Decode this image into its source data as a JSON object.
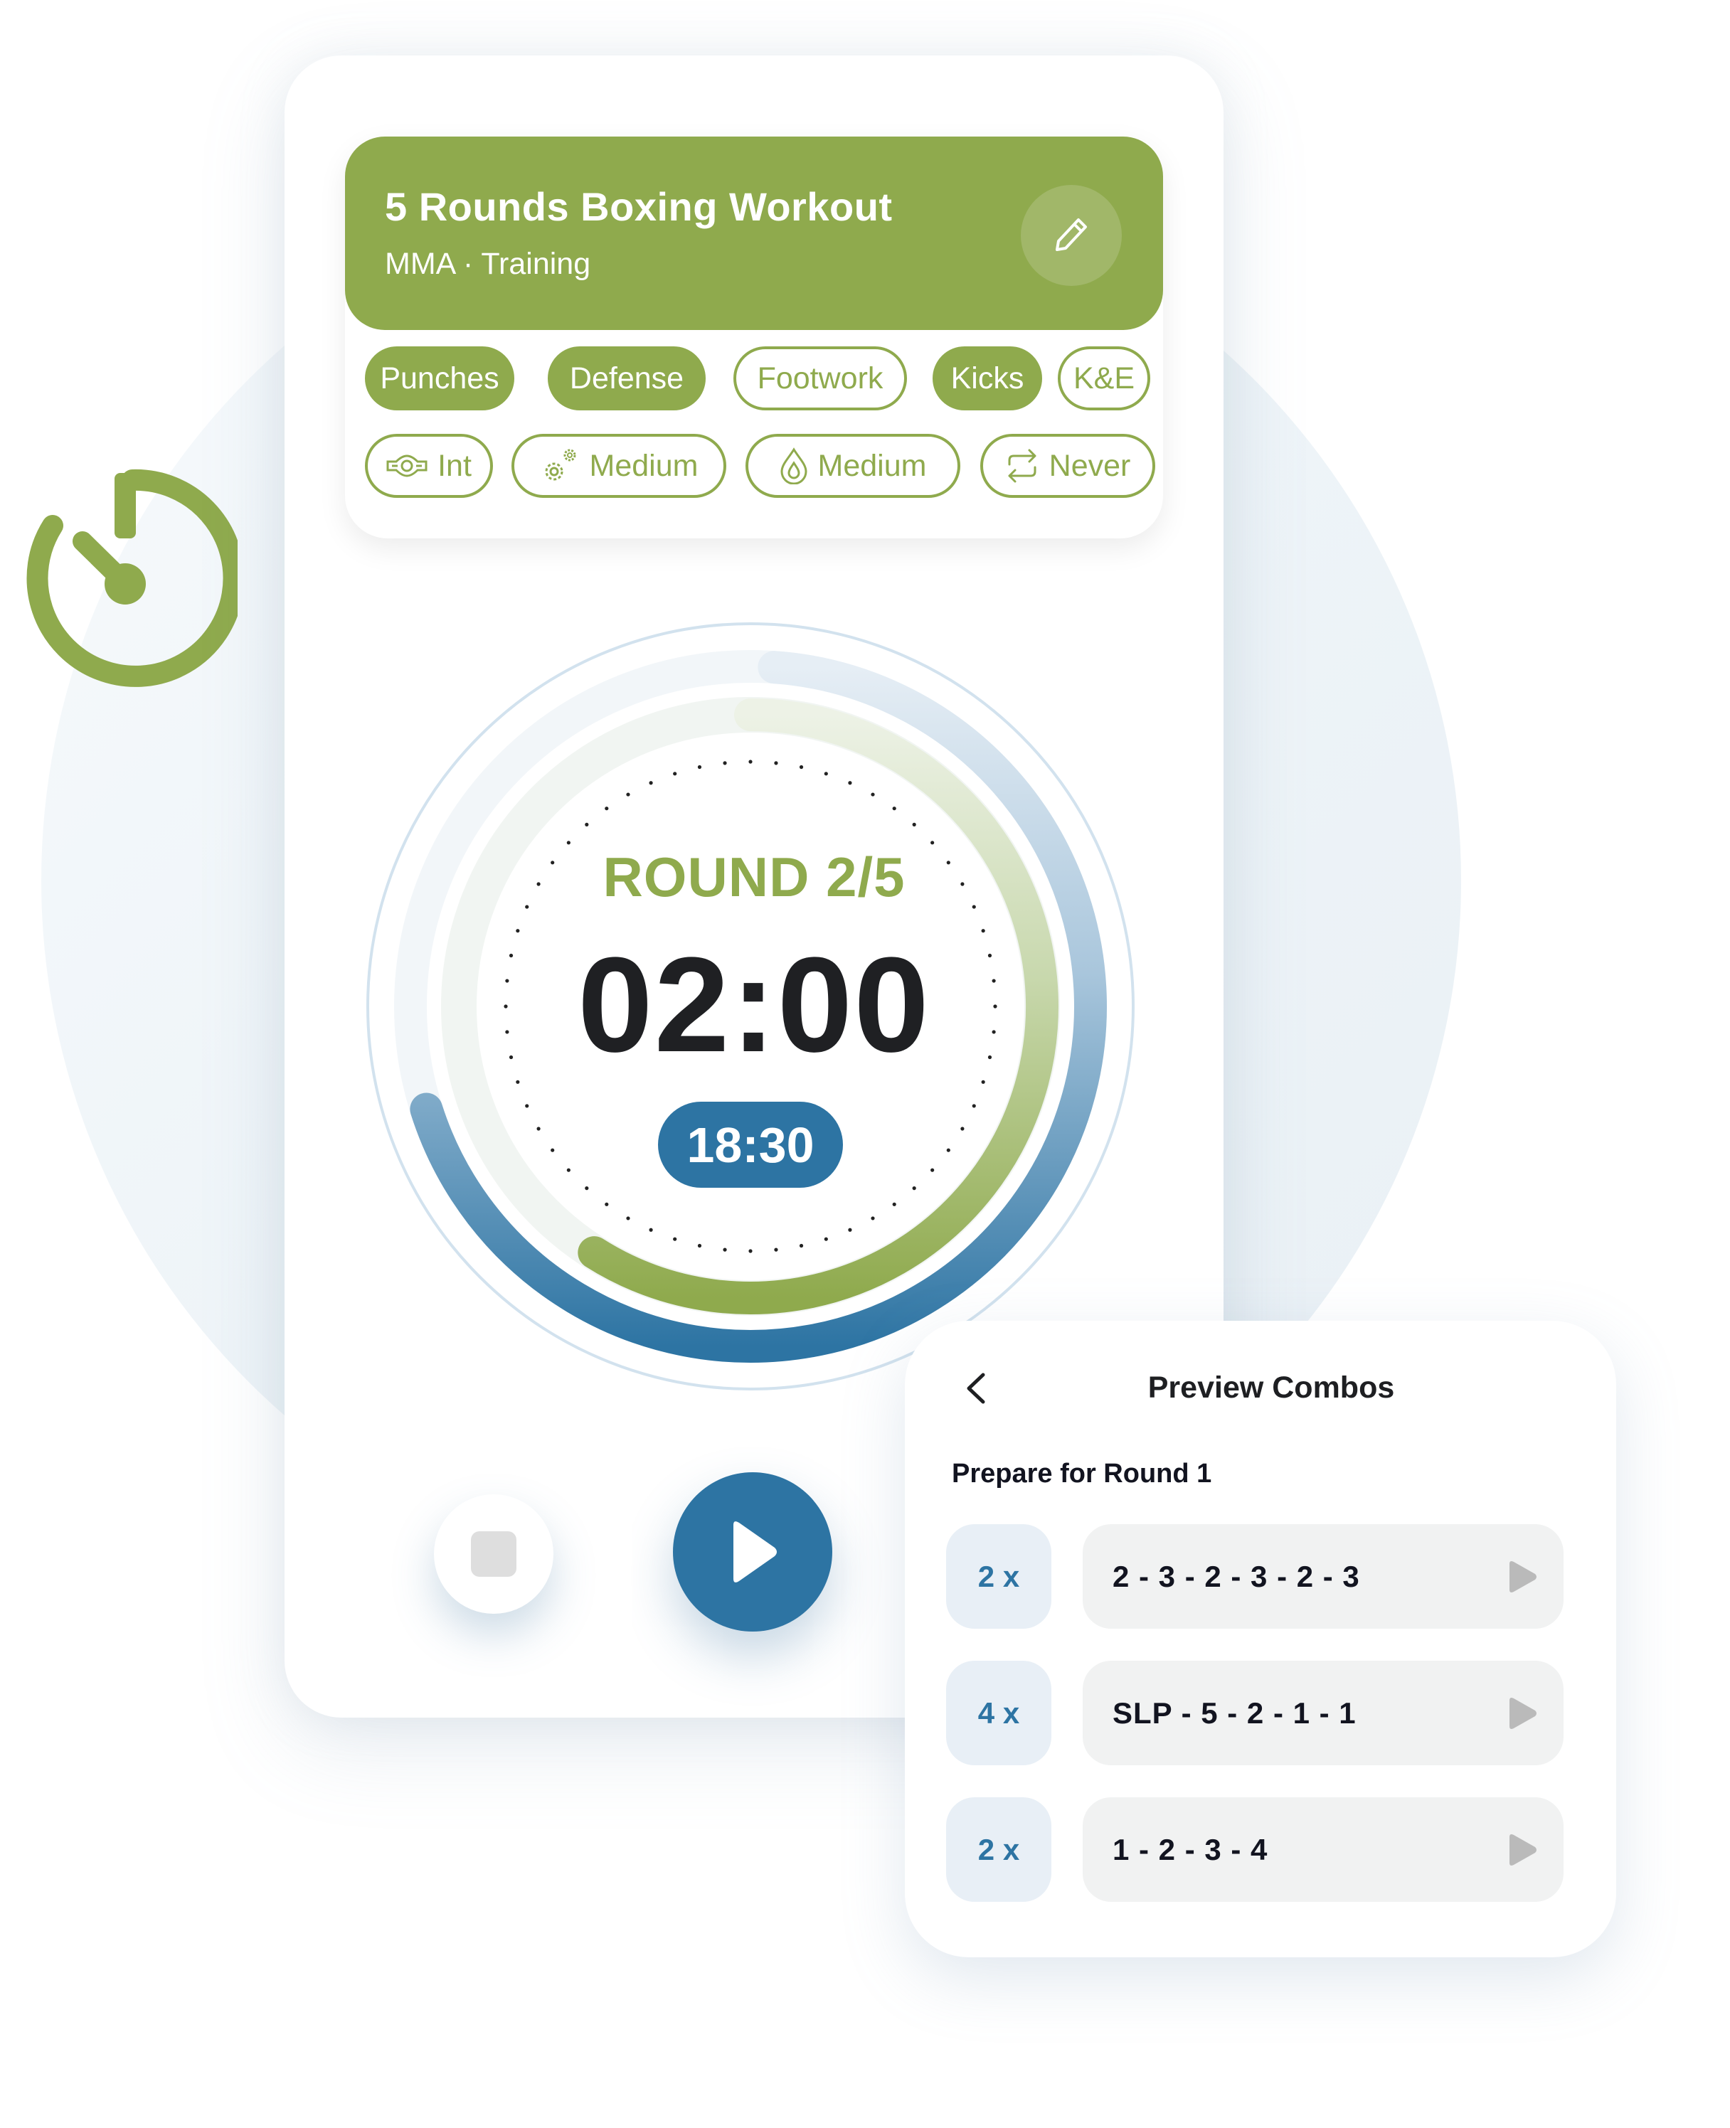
{
  "colors": {
    "brand_green": "#8faa4d",
    "brand_blue": "#2d74a3",
    "text_dark": "#1f2023",
    "background_circle": "#eef4f8"
  },
  "workout": {
    "title": "5 Rounds Boxing Workout",
    "subtitle": "MMA · Training",
    "edit_icon": "pencil-icon"
  },
  "tags": {
    "categories": [
      {
        "label": "Punches",
        "selected": true
      },
      {
        "label": "Defense",
        "selected": true
      },
      {
        "label": "Footwork",
        "selected": false
      },
      {
        "label": "Kicks",
        "selected": true
      },
      {
        "label": "K&E",
        "selected": false
      }
    ],
    "settings": [
      {
        "icon": "belt-icon",
        "label": "Int"
      },
      {
        "icon": "gears-icon",
        "label": "Medium"
      },
      {
        "icon": "drop-icon",
        "label": "Medium"
      },
      {
        "icon": "repeat-icon",
        "label": "Never"
      }
    ]
  },
  "timer": {
    "round_label": "ROUND 2/5",
    "round_current": 2,
    "round_total": 5,
    "time_remaining": "02:00",
    "total_remaining": "18:30",
    "outer_progress_fraction": 0.69,
    "inner_progress_fraction": 0.59
  },
  "controls": {
    "stop_icon": "stop-icon",
    "play_icon": "play-icon"
  },
  "preview": {
    "title": "Preview Combos",
    "back_icon": "chevron-left-icon",
    "section_label": "Prepare for Round 1",
    "combos": [
      {
        "count": "2 x",
        "sequence": "2 - 3 - 2 - 3 - 2 - 3"
      },
      {
        "count": "4 x",
        "sequence": "SLP - 5 - 2 - 1 - 1"
      },
      {
        "count": "2 x",
        "sequence": "1 - 2 - 3 - 4"
      }
    ]
  }
}
